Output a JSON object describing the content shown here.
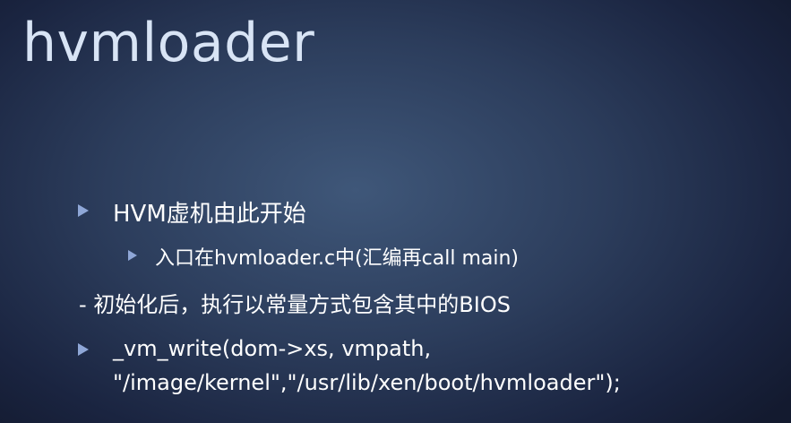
{
  "slide": {
    "title": "hvmloader",
    "bullets": [
      {
        "text": "HVM虚机由此开始"
      },
      {
        "text": "入口在hvmloader.c中(汇编再call main)"
      },
      {
        "text": "- 初始化后，执行以常量方式包含其中的BIOS"
      },
      {
        "line1": "_vm_write(dom->xs, vmpath,",
        "line2": "\"/image/kernel\",\"/usr/lib/xen/boot/hvmloader\");"
      }
    ],
    "colors": {
      "background_center": "#3f5779",
      "background_edge": "#131a2f",
      "title": "#d8e4f5",
      "bullet_marker": "#8fa7d7",
      "text": "#ffffff"
    }
  }
}
